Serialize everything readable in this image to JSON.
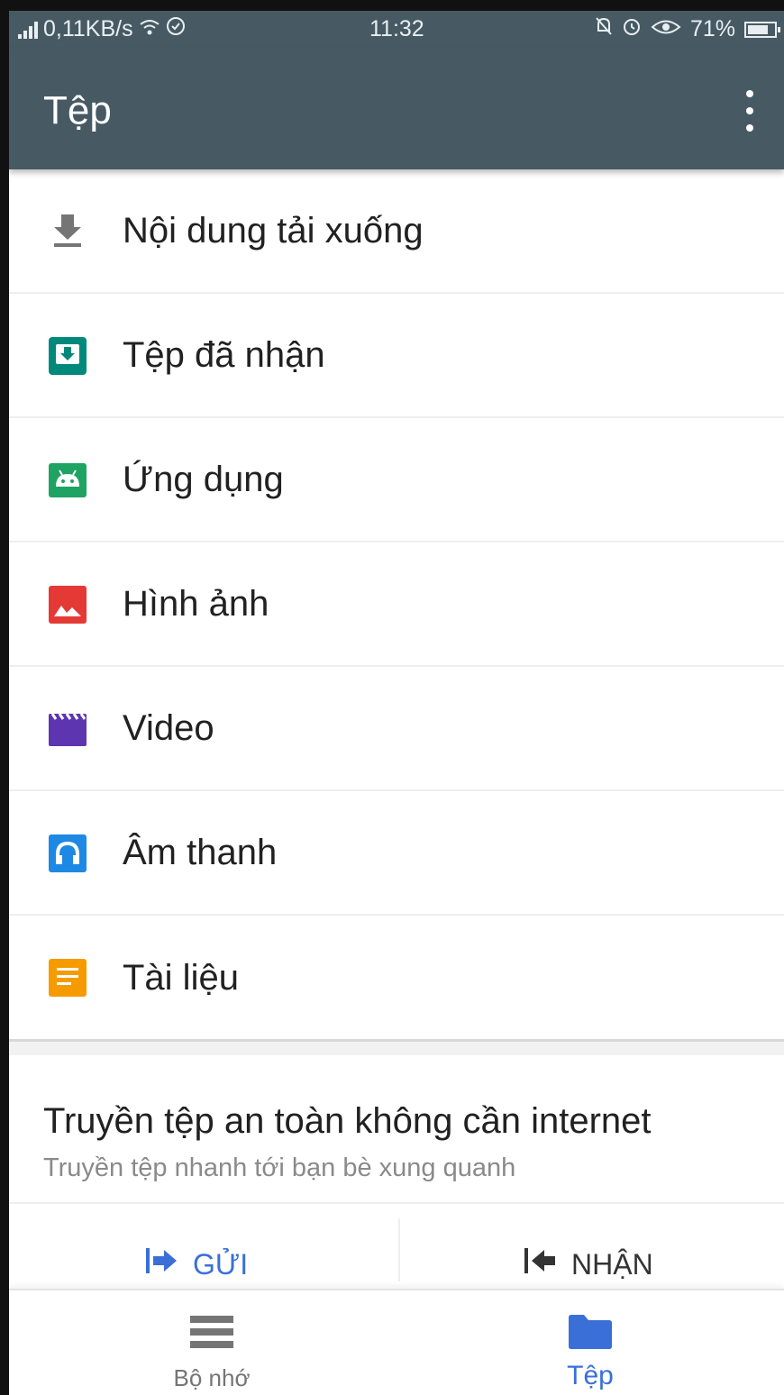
{
  "status_bar": {
    "speed": "0,11KB/s",
    "time": "11:32",
    "battery": "71%"
  },
  "app_bar": {
    "title": "Tệp"
  },
  "list": {
    "items": [
      {
        "label": "Nội dung tải xuống",
        "icon": "download-icon",
        "color": "#757575"
      },
      {
        "label": "Tệp đã nhận",
        "icon": "received-files-icon",
        "color": "#00897b"
      },
      {
        "label": "Ứng dụng",
        "icon": "android-icon",
        "color": "#1ea362"
      },
      {
        "label": "Hình ảnh",
        "icon": "image-icon",
        "color": "#e53935"
      },
      {
        "label": "Video",
        "icon": "video-icon",
        "color": "#5e35b1"
      },
      {
        "label": "Âm thanh",
        "icon": "headphones-icon",
        "color": "#1e88e5"
      },
      {
        "label": "Tài liệu",
        "icon": "document-icon",
        "color": "#f59b00"
      }
    ]
  },
  "transfer": {
    "title": "Truyền tệp an toàn không cần internet",
    "subtitle": "Truyền tệp nhanh tới bạn bè xung quanh",
    "send_label": "GỬI",
    "receive_label": "NHẬN"
  },
  "bottom_nav": {
    "storage_label": "Bộ nhớ",
    "files_label": "Tệp"
  },
  "colors": {
    "app_bar": "#475a64",
    "accent": "#3a6fd8"
  }
}
